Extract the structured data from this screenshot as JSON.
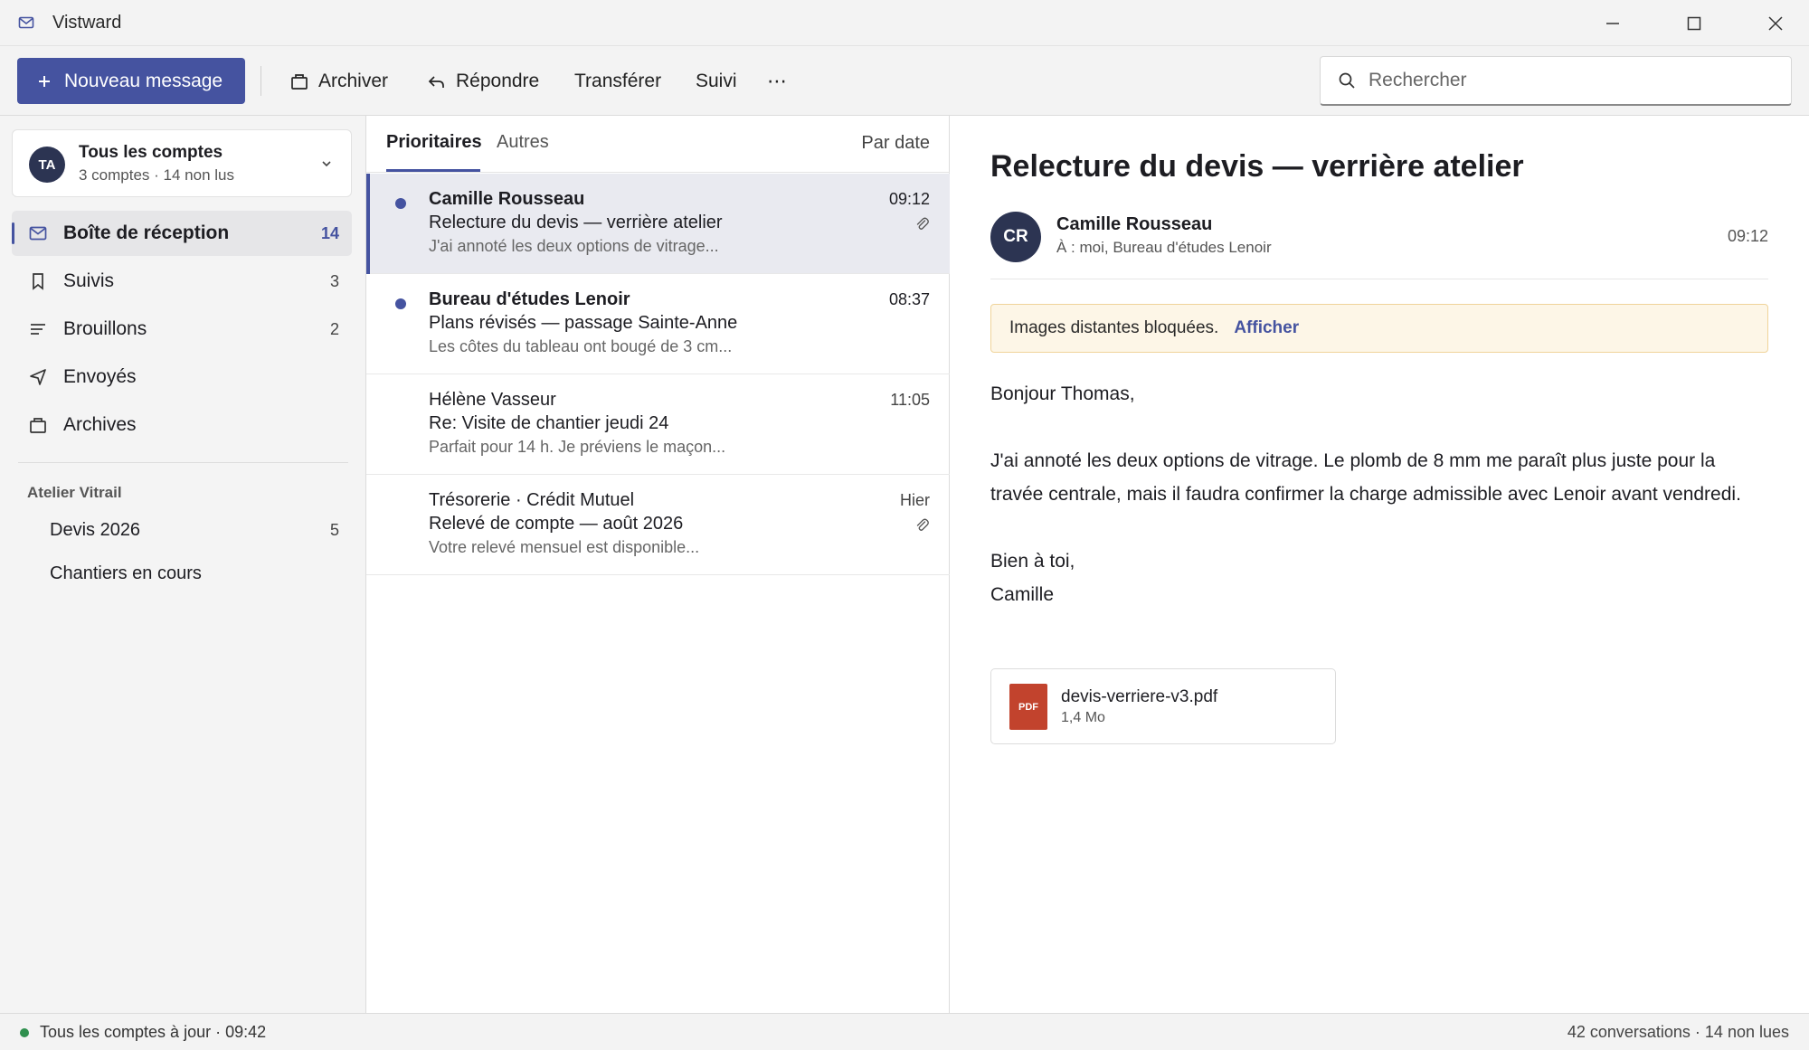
{
  "window": {
    "title": "Vistward",
    "icon": "mail-icon"
  },
  "toolbar": {
    "new_message": "Nouveau message",
    "archive": "Archiver",
    "reply": "Répondre",
    "forward": "Transférer",
    "follow": "Suivi",
    "more": "⋯",
    "search_placeholder": "Rechercher"
  },
  "sidebar": {
    "account": {
      "initials": "TA",
      "title": "Tous les comptes",
      "subtitle": "3 comptes · 14 non lus"
    },
    "items": [
      {
        "label": "Boîte de réception",
        "count": "14",
        "icon": "inbox-icon",
        "active": true
      },
      {
        "label": "Suivis",
        "count": "3",
        "icon": "bookmark-icon"
      },
      {
        "label": "Brouillons",
        "count": "2",
        "icon": "drafts-icon"
      },
      {
        "label": "Envoyés",
        "count": "",
        "icon": "send-icon"
      },
      {
        "label": "Archives",
        "count": "",
        "icon": "archive-icon"
      }
    ],
    "group": {
      "title": "Atelier Vitrail",
      "folders": [
        {
          "label": "Devis 2026",
          "count": "5"
        },
        {
          "label": "Chantiers en cours",
          "count": ""
        }
      ]
    }
  },
  "list": {
    "tabs": [
      "Prioritaires",
      "Autres"
    ],
    "sort": "Par date",
    "messages": [
      {
        "sender": "Camille Rousseau",
        "subject": "Relecture du devis — verrière atelier",
        "preview": "J'ai annoté les deux options de vitrage...",
        "time": "09:12",
        "unread": true,
        "attachment": true,
        "selected": true
      },
      {
        "sender": "Bureau d'études Lenoir",
        "subject": "Plans révisés — passage Sainte-Anne",
        "preview": "Les côtes du tableau ont bougé de 3 cm...",
        "time": "08:37",
        "unread": true,
        "attachment": false
      },
      {
        "sender": "Hélène Vasseur",
        "subject": "Re: Visite de chantier jeudi 24",
        "preview": "Parfait pour 14 h. Je préviens le maçon...",
        "time": "11:05",
        "unread": false,
        "attachment": false
      },
      {
        "sender": "Trésorerie · Crédit Mutuel",
        "subject": "Relevé de compte — août 2026",
        "preview": "Votre relevé mensuel est disponible...",
        "time": "Hier",
        "unread": false,
        "attachment": true
      }
    ]
  },
  "reader": {
    "subject": "Relecture du devis — verrière atelier",
    "initials": "CR",
    "from": "Camille Rousseau",
    "to": "À : moi, Bureau d'études Lenoir",
    "time": "09:12",
    "banner_text": "Images distantes bloquées.",
    "banner_link": "Afficher",
    "body": {
      "greeting": "Bonjour Thomas,",
      "paragraph": "J'ai annoté les deux options de vitrage. Le plomb de 8 mm me paraît plus juste pour la travée centrale, mais il faudra confirmer la charge admissible avec Lenoir avant vendredi.",
      "closing": "Bien à toi,",
      "signature": "Camille"
    },
    "attachment": {
      "type": "PDF",
      "name": "devis-verriere-v3.pdf",
      "size": "1,4 Mo"
    }
  },
  "status": {
    "left": "Tous les comptes à jour · 09:42",
    "right": "42 conversations · 14 non lues"
  },
  "colors": {
    "accent": "#4553a0",
    "avatar": "#2c3452",
    "pdf": "#c2432d",
    "online": "#2f8f4e",
    "banner_bg": "#fdf6e7"
  }
}
